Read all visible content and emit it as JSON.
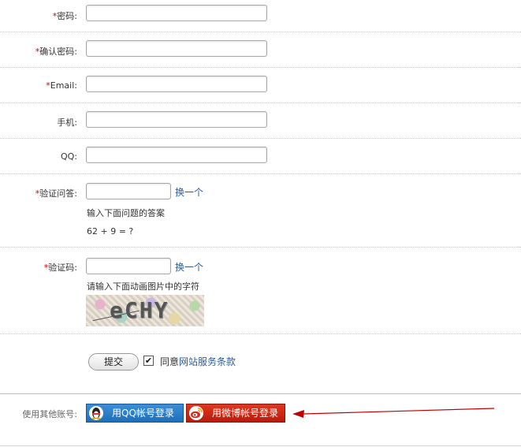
{
  "form": {
    "password": {
      "label": "密码:",
      "required": "*"
    },
    "confirm_password": {
      "label": "确认密码:",
      "required": "*"
    },
    "email": {
      "label": "Email:",
      "required": "*"
    },
    "phone": {
      "label": "手机:"
    },
    "qq": {
      "label": "QQ:"
    },
    "question": {
      "label": "验证问答:",
      "required": "*",
      "change": "换一个",
      "hint": "输入下面问题的答案",
      "text": "62 + 9 = ?"
    },
    "captcha": {
      "label": "验证码:",
      "required": "*",
      "change": "换一个",
      "hint": "请输入下面动画图片中的字符",
      "image_text": "eCHY"
    },
    "submit": "提交",
    "agree_prefix": "同意",
    "agree_link": "网站服务条款"
  },
  "social": {
    "label": "使用其他账号:",
    "qq_button": "用QQ帐号登录",
    "weibo_button": "用微博帐号登录"
  },
  "colors": {
    "required": "#d40000",
    "link": "#2b5c9a",
    "qq": "#1f6fb8",
    "weibo": "#c8230f",
    "arrow": "#c00000"
  }
}
